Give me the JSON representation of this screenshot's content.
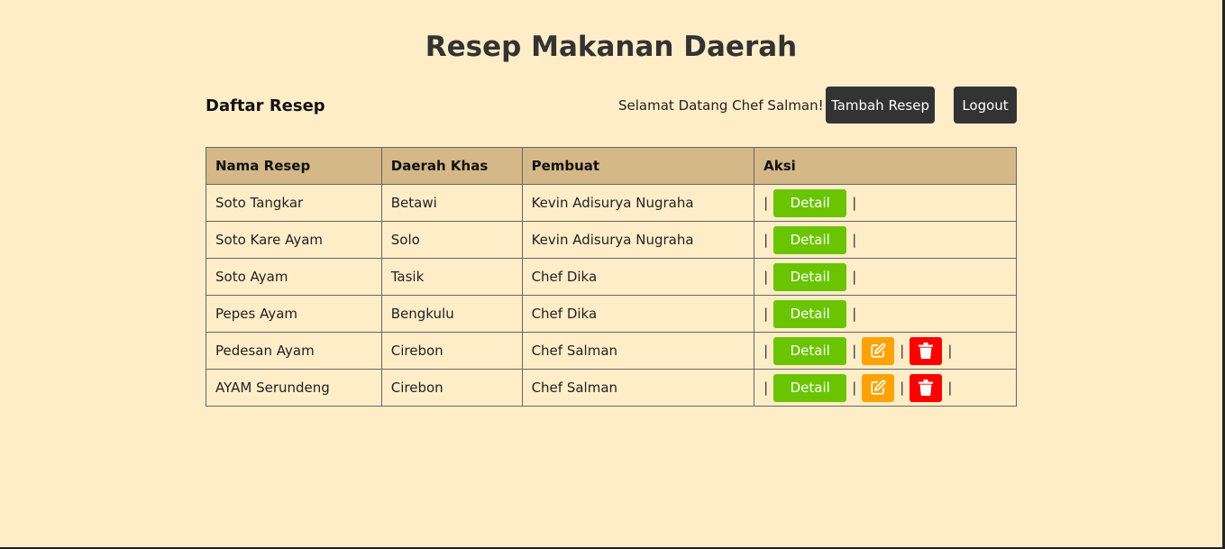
{
  "header": {
    "title": "Resep Makanan Daerah",
    "section_title": "Daftar Resep",
    "welcome_text": "Selamat Datang Chef Salman!",
    "add_button": "Tambah Resep",
    "logout_button": "Logout"
  },
  "table": {
    "columns": [
      "Nama Resep",
      "Daerah Khas",
      "Pembuat",
      "Aksi"
    ],
    "detail_label": "Detail",
    "separator": "|",
    "rows": [
      {
        "nama": "Soto Tangkar",
        "daerah": "Betawi",
        "pembuat": "Kevin Adisurya Nugraha",
        "can_edit": false
      },
      {
        "nama": "Soto Kare Ayam",
        "daerah": "Solo",
        "pembuat": "Kevin Adisurya Nugraha",
        "can_edit": false
      },
      {
        "nama": "Soto Ayam",
        "daerah": "Tasik",
        "pembuat": "Chef Dika",
        "can_edit": false
      },
      {
        "nama": "Pepes Ayam",
        "daerah": "Bengkulu",
        "pembuat": "Chef Dika",
        "can_edit": false
      },
      {
        "nama": "Pedesan Ayam",
        "daerah": "Cirebon",
        "pembuat": "Chef Salman",
        "can_edit": true
      },
      {
        "nama": "AYAM Serundeng",
        "daerah": "Cirebon",
        "pembuat": "Chef Salman",
        "can_edit": true
      }
    ]
  },
  "colors": {
    "background": "#ffedc8",
    "header_row": "#d4b888",
    "detail": "#6ac400",
    "edit": "#ffa200",
    "delete": "#ff0000",
    "dark_button": "#333333"
  },
  "icons": {
    "edit": "edit-icon",
    "delete": "trash-icon"
  }
}
